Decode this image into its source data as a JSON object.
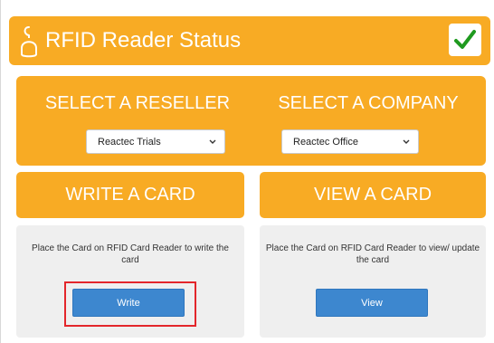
{
  "header": {
    "title": "RFID Reader Status",
    "icon": "rfid-reader-icon",
    "status_icon": "checkmark-icon",
    "status_color": "#1f9a1f",
    "accent_color": "#f8ab24"
  },
  "selectors": {
    "reseller": {
      "heading": "SELECT A RESELLER",
      "selected": "Reactec Trials"
    },
    "company": {
      "heading": "SELECT A COMPANY",
      "selected": "Reactec Office"
    }
  },
  "write_card": {
    "heading": "WRITE A CARD",
    "instructions": "Place the Card on RFID Card Reader to write the card",
    "button_label": "Write"
  },
  "view_card": {
    "heading": "VIEW A CARD",
    "instructions": "Place the Card on RFID Card Reader to view/ update the card",
    "button_label": "View"
  },
  "button_color": "#3d87cf",
  "highlight_color": "#e3262b"
}
